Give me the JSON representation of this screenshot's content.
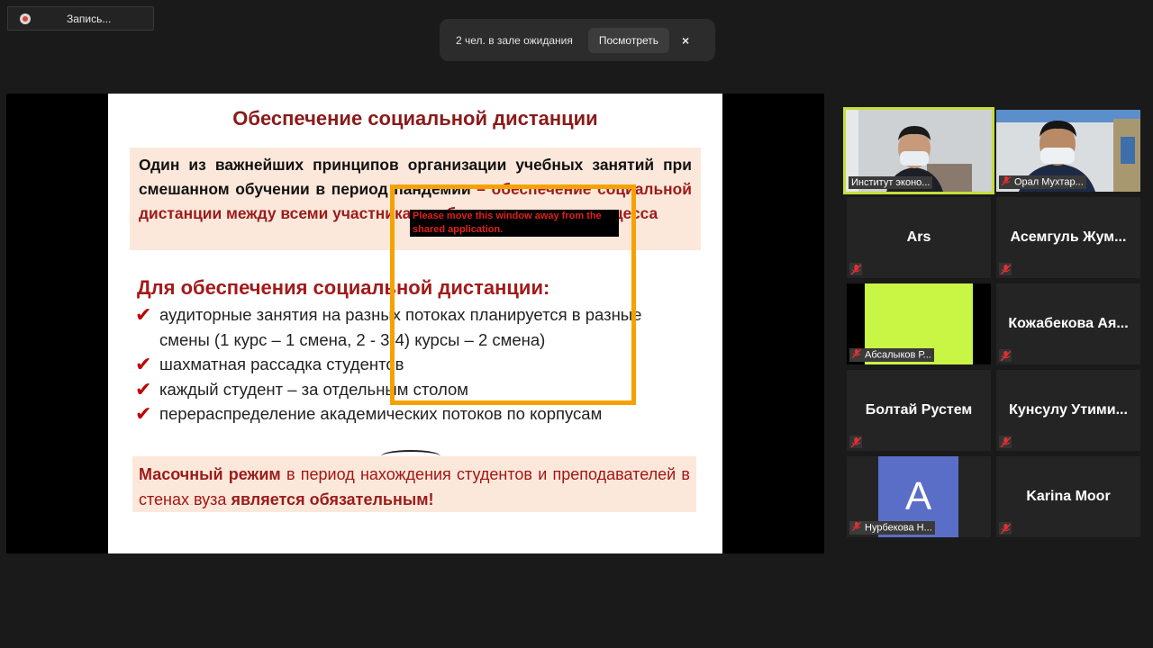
{
  "recording": {
    "label": "Запись..."
  },
  "waiting_room": {
    "message": "2 чел. в зале ожидания",
    "view_button": "Посмотреть",
    "close": "×"
  },
  "slide": {
    "title": "Обеспечение социальной дистанции",
    "intro_black": "Один из важнейших принципов организации учебных занятий при смешанном обучении в период пандемии",
    "intro_red": " – обеспечение социальной дистанции между всеми участниками образовательного процесса",
    "subheading": "Для обеспечения социальной дистанции:",
    "bullets": [
      "аудиторные занятия на разных потоках планируется в разные смены (1 курс – 1 смена, 2 - 3(4) курсы – 2 смена)",
      "шахматная рассадка студентов",
      "каждый студент – за отдельным столом",
      "перераспределение академических потоков по корпусам"
    ],
    "mask_bold": "Масочный режим",
    "mask_middle": " в период нахождения студентов и преподавателей в стенах вуза ",
    "mask_end": "является обязательным!"
  },
  "overlay": {
    "warning": "Please move this window away from the shared application."
  },
  "participants": [
    {
      "name": "Институт эконо..."
    },
    {
      "name": "Орал Мухтар..."
    },
    {
      "name": "Ars"
    },
    {
      "name": "Асемгуль Жум..."
    },
    {
      "name": "Абсалыков Р..."
    },
    {
      "name": "Кожабекова Ая..."
    },
    {
      "name": "Болтай Рустем"
    },
    {
      "name": "Кунсулу Утими..."
    },
    {
      "name": "Нурбекова Н...",
      "initial": "A"
    },
    {
      "name": "Karina Moor"
    }
  ],
  "colors": {
    "active_speaker": "#c4df3a",
    "avatar_bg": "#5a6ec8",
    "lime_video": "#c9f545"
  }
}
